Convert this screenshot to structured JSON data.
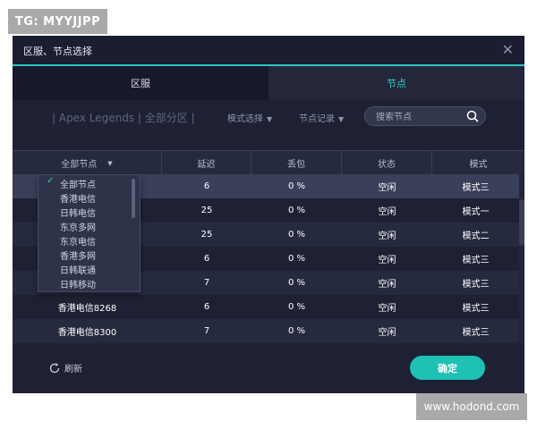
{
  "watermarks": {
    "top_left": "TG: MYYJJPP",
    "bottom_right": "www.hodond.com"
  },
  "dialog": {
    "title": "区服、节点选择",
    "close_icon": "close-icon",
    "tabs": [
      {
        "label": "区服",
        "active": false
      },
      {
        "label": "节点",
        "active": true
      }
    ],
    "filter": {
      "game_label": "| Apex Legends | 全部分区 |",
      "mode_select": "模式选择",
      "node_record": "节点记录",
      "search_placeholder": "搜索节点",
      "search_icon": "search-icon"
    },
    "table": {
      "columns": [
        "全部节点",
        "延迟",
        "丢包",
        "状态",
        "模式"
      ],
      "rows": [
        {
          "name": "",
          "latency": "6",
          "loss": "0 %",
          "status": "空闲",
          "mode": "模式三"
        },
        {
          "name": "",
          "latency": "25",
          "loss": "0 %",
          "status": "空闲",
          "mode": "模式一"
        },
        {
          "name": "",
          "latency": "25",
          "loss": "0 %",
          "status": "空闲",
          "mode": "模式二"
        },
        {
          "name": "",
          "latency": "6",
          "loss": "0 %",
          "status": "空闲",
          "mode": "模式三"
        },
        {
          "name": "",
          "latency": "7",
          "loss": "0 %",
          "status": "空闲",
          "mode": "模式三"
        },
        {
          "name": "香港电信8268",
          "latency": "6",
          "loss": "0 %",
          "status": "空闲",
          "mode": "模式三"
        },
        {
          "name": "香港电信8300",
          "latency": "7",
          "loss": "0 %",
          "status": "空闲",
          "mode": "模式三"
        }
      ]
    },
    "node_dropdown": {
      "selected": "全部节点",
      "options": [
        "全部节点",
        "香港电信",
        "日韩电信",
        "东京多网",
        "东京电信",
        "香港多网",
        "日韩联通",
        "日韩移动"
      ]
    },
    "footer": {
      "refresh_label": "刷新",
      "refresh_icon": "refresh-icon",
      "confirm_label": "确定"
    },
    "colors": {
      "accent": "#1ec1b3",
      "background": "#1e2134",
      "active_tab_text": "#2fd1c7"
    }
  }
}
